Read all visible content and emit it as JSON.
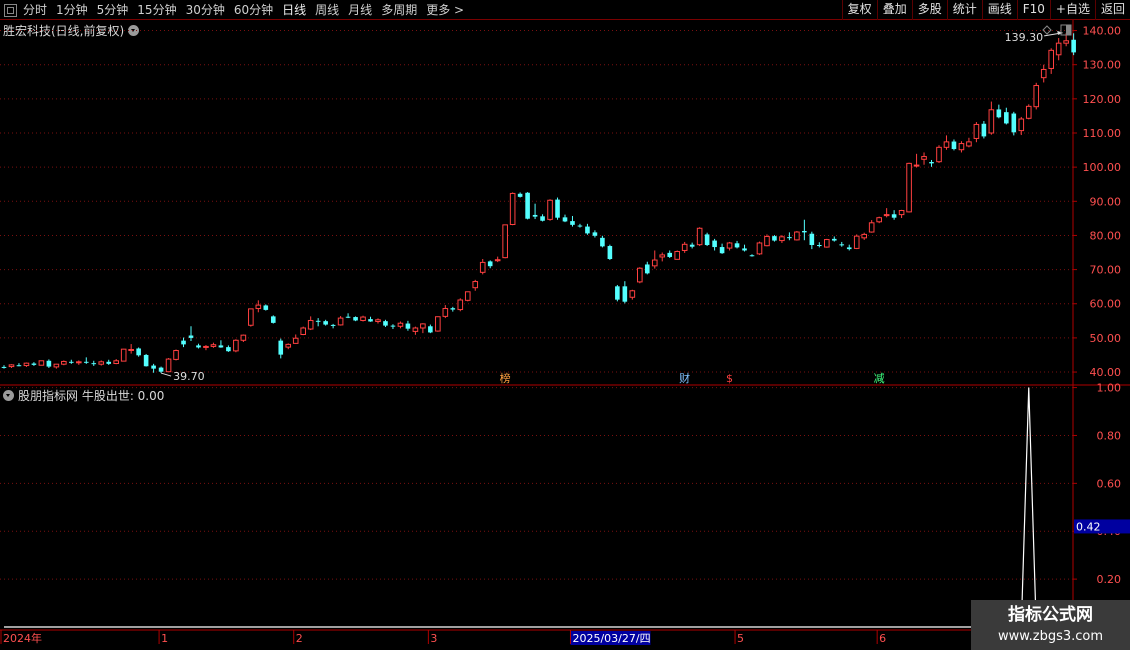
{
  "toolbar": {
    "periods": [
      "分时",
      "1分钟",
      "5分钟",
      "15分钟",
      "30分钟",
      "60分钟",
      "日线",
      "周线",
      "月线",
      "多周期",
      "更多 >"
    ],
    "active_period": "日线",
    "buttons": [
      "复权",
      "叠加",
      "多股",
      "统计",
      "画线",
      "F10",
      "+自选",
      "返回"
    ]
  },
  "stock_title": "胜宏科技(日线,前复权)",
  "indicator_title": "股朋指标网 牛股出世: 0.00",
  "watermark": {
    "line1": "指标公式网",
    "line2": "www.zbgs3.com"
  },
  "colors": {
    "up": "#ff4040",
    "down": "#54ffff",
    "grid": "#7a1010",
    "axis": "#b00000",
    "indicator_line": "#ffffff",
    "cursor_box": "#0000a0"
  },
  "chart_data": [
    {
      "type": "candlestick",
      "title": "胜宏科技(日线,前复权)",
      "ylim": [
        36.5,
        142.5
      ],
      "yticks": [
        "140.00",
        "130.00",
        "120.00",
        "110.00",
        "100.00",
        "90.00",
        "80.00",
        "70.00",
        "60.00",
        "50.00",
        "40.00"
      ],
      "annotations": {
        "low_label": "39.70",
        "high_label": "139.30"
      },
      "markers": [
        {
          "text": "榜",
          "color": "#ffa040"
        },
        {
          "text": "财",
          "color": "#80c0ff"
        },
        {
          "text": "$",
          "color": "#ff4040"
        },
        {
          "text": "减",
          "color": "#40ff80"
        }
      ],
      "candles_ohlc": [
        [
          41.5,
          42.0,
          41.0,
          41.3
        ],
        [
          41.6,
          42.3,
          41.2,
          42.1
        ],
        [
          42.0,
          42.6,
          41.7,
          41.8
        ],
        [
          41.9,
          42.8,
          41.5,
          42.6
        ],
        [
          42.5,
          42.9,
          41.8,
          42.1
        ],
        [
          42.0,
          43.4,
          41.9,
          43.3
        ],
        [
          43.3,
          43.7,
          41.2,
          41.6
        ],
        [
          41.5,
          42.4,
          41.0,
          42.3
        ],
        [
          42.3,
          43.4,
          42.0,
          43.1
        ],
        [
          43.0,
          43.6,
          42.4,
          42.8
        ],
        [
          42.8,
          43.4,
          42.1,
          43.0
        ],
        [
          43.0,
          44.3,
          42.4,
          42.8
        ],
        [
          42.6,
          43.3,
          41.8,
          42.4
        ],
        [
          42.3,
          43.4,
          41.9,
          43.0
        ],
        [
          43.0,
          43.6,
          42.1,
          42.4
        ],
        [
          42.5,
          43.8,
          42.3,
          43.3
        ],
        [
          43.2,
          46.8,
          43.1,
          46.7
        ],
        [
          46.6,
          48.2,
          45.4,
          46.6
        ],
        [
          46.9,
          47.2,
          44.5,
          44.9
        ],
        [
          45.0,
          45.3,
          41.6,
          41.7
        ],
        [
          41.9,
          42.4,
          39.8,
          41.0
        ],
        [
          41.3,
          41.6,
          39.7,
          40.1
        ],
        [
          40.1,
          44.1,
          40.0,
          43.8
        ],
        [
          43.7,
          46.6,
          43.4,
          46.3
        ],
        [
          49.2,
          50.1,
          47.3,
          48.1
        ],
        [
          50.7,
          53.4,
          49.1,
          50.0
        ],
        [
          47.8,
          48.3,
          46.9,
          47.2
        ],
        [
          47.2,
          47.9,
          46.4,
          47.5
        ],
        [
          47.5,
          48.6,
          47.1,
          48.0
        ],
        [
          47.8,
          49.3,
          47.1,
          47.2
        ],
        [
          47.3,
          47.8,
          45.9,
          46.1
        ],
        [
          46.2,
          49.6,
          45.8,
          49.3
        ],
        [
          49.3,
          51.0,
          48.8,
          50.8
        ],
        [
          53.7,
          58.6,
          53.3,
          58.5
        ],
        [
          58.6,
          61.0,
          57.5,
          59.6
        ],
        [
          59.5,
          59.8,
          58.0,
          58.2
        ],
        [
          56.3,
          56.6,
          54.2,
          54.4
        ],
        [
          49.2,
          49.8,
          44.0,
          45.1
        ],
        [
          47.3,
          48.4,
          46.7,
          48.1
        ],
        [
          48.4,
          51.0,
          48.3,
          49.9
        ],
        [
          51.0,
          53.3,
          50.8,
          52.9
        ],
        [
          52.6,
          56.3,
          52.3,
          55.1
        ],
        [
          55.0,
          55.8,
          53.4,
          54.9
        ],
        [
          54.9,
          55.3,
          53.6,
          53.9
        ],
        [
          53.8,
          54.1,
          52.8,
          53.6
        ],
        [
          53.8,
          56.4,
          53.6,
          55.8
        ],
        [
          56.2,
          57.2,
          55.8,
          56.1
        ],
        [
          56.1,
          56.3,
          54.9,
          55.1
        ],
        [
          55.1,
          56.5,
          54.8,
          56.1
        ],
        [
          55.5,
          56.2,
          54.7,
          54.8
        ],
        [
          54.8,
          55.7,
          54.2,
          55.3
        ],
        [
          54.9,
          55.3,
          53.2,
          53.6
        ],
        [
          53.6,
          54.0,
          52.6,
          53.3
        ],
        [
          53.4,
          54.8,
          52.8,
          54.3
        ],
        [
          54.2,
          55.0,
          52.1,
          52.7
        ],
        [
          51.9,
          53.3,
          50.9,
          52.9
        ],
        [
          52.9,
          54.3,
          51.4,
          54.1
        ],
        [
          53.4,
          53.9,
          51.4,
          51.6
        ],
        [
          52.0,
          56.3,
          51.8,
          56.2
        ],
        [
          56.3,
          59.6,
          55.8,
          58.6
        ],
        [
          58.7,
          59.1,
          57.7,
          58.3
        ],
        [
          58.3,
          61.6,
          57.8,
          61.1
        ],
        [
          61.0,
          63.6,
          60.7,
          63.5
        ],
        [
          64.7,
          67.0,
          63.8,
          66.5
        ],
        [
          69.2,
          73.1,
          68.6,
          72.1
        ],
        [
          72.4,
          72.7,
          70.4,
          71.0
        ],
        [
          72.6,
          73.8,
          72.2,
          72.9
        ],
        [
          73.5,
          83.2,
          73.3,
          83.1
        ],
        [
          83.2,
          92.6,
          83.0,
          92.3
        ],
        [
          92.2,
          92.6,
          91.1,
          91.3
        ],
        [
          92.5,
          92.7,
          84.7,
          84.9
        ],
        [
          86.0,
          89.3,
          84.8,
          85.5
        ],
        [
          85.6,
          86.2,
          84.1,
          84.3
        ],
        [
          84.7,
          90.6,
          84.3,
          90.3
        ],
        [
          90.5,
          91.1,
          84.6,
          85.2
        ],
        [
          85.3,
          86.1,
          83.9,
          84.1
        ],
        [
          84.2,
          85.7,
          82.6,
          83.1
        ],
        [
          82.9,
          83.4,
          82.3,
          82.7
        ],
        [
          82.6,
          83.4,
          80.2,
          80.6
        ],
        [
          80.9,
          81.5,
          79.4,
          79.9
        ],
        [
          79.3,
          79.9,
          76.5,
          76.8
        ],
        [
          76.9,
          77.3,
          72.8,
          73.1
        ],
        [
          65.1,
          65.5,
          60.7,
          61.2
        ],
        [
          65.1,
          66.6,
          60.1,
          60.6
        ],
        [
          61.9,
          64.1,
          61.2,
          63.8
        ],
        [
          66.4,
          70.7,
          66.0,
          70.4
        ],
        [
          71.5,
          72.3,
          68.6,
          68.9
        ],
        [
          71.1,
          75.6,
          70.3,
          72.8
        ],
        [
          73.7,
          75.0,
          72.4,
          74.3
        ],
        [
          74.9,
          75.6,
          73.4,
          73.7
        ],
        [
          73.0,
          75.6,
          72.9,
          75.3
        ],
        [
          75.6,
          78.1,
          74.9,
          77.4
        ],
        [
          77.3,
          77.9,
          76.2,
          76.7
        ],
        [
          77.3,
          82.4,
          76.9,
          82.1
        ],
        [
          80.3,
          80.8,
          76.9,
          77.2
        ],
        [
          78.5,
          79.0,
          75.6,
          76.6
        ],
        [
          76.6,
          77.6,
          74.6,
          74.8
        ],
        [
          76.3,
          78.1,
          75.6,
          77.8
        ],
        [
          77.7,
          78.4,
          76.2,
          76.5
        ],
        [
          76.2,
          77.3,
          75.3,
          75.6
        ],
        [
          74.2,
          74.5,
          73.8,
          74.1
        ],
        [
          74.6,
          78.2,
          74.3,
          77.8
        ],
        [
          77.0,
          80.3,
          76.8,
          79.7
        ],
        [
          79.8,
          80.1,
          78.2,
          78.5
        ],
        [
          78.5,
          80.1,
          77.8,
          79.6
        ],
        [
          79.5,
          80.9,
          78.6,
          79.2
        ],
        [
          78.7,
          81.3,
          78.5,
          81.0
        ],
        [
          81.3,
          84.6,
          78.6,
          80.9
        ],
        [
          80.5,
          81.1,
          76.0,
          77.2
        ],
        [
          77.2,
          78.0,
          76.5,
          76.9
        ],
        [
          76.6,
          79.0,
          76.4,
          78.8
        ],
        [
          79.0,
          79.7,
          78.2,
          78.5
        ],
        [
          77.4,
          78.1,
          76.7,
          77.1
        ],
        [
          76.5,
          77.3,
          75.6,
          76.0
        ],
        [
          76.2,
          80.3,
          76.0,
          79.8
        ],
        [
          79.3,
          80.8,
          78.7,
          80.3
        ],
        [
          81.0,
          84.5,
          80.8,
          83.7
        ],
        [
          84.0,
          85.5,
          83.6,
          85.2
        ],
        [
          85.8,
          88.0,
          85.3,
          86.1
        ],
        [
          86.2,
          87.4,
          84.6,
          85.2
        ],
        [
          86.1,
          87.5,
          85.1,
          87.3
        ],
        [
          86.9,
          101.3,
          86.7,
          101.1
        ],
        [
          100.4,
          103.9,
          99.9,
          100.6
        ],
        [
          102.3,
          104.3,
          100.7,
          103.1
        ],
        [
          101.5,
          102.1,
          100.1,
          101.1
        ],
        [
          101.6,
          106.4,
          101.2,
          105.8
        ],
        [
          105.8,
          109.3,
          105.1,
          107.4
        ],
        [
          107.5,
          108.1,
          104.9,
          105.3
        ],
        [
          105.1,
          107.6,
          104.3,
          106.9
        ],
        [
          106.2,
          108.6,
          105.8,
          107.4
        ],
        [
          108.4,
          113.2,
          107.3,
          112.5
        ],
        [
          112.7,
          113.5,
          108.4,
          109.0
        ],
        [
          110.0,
          119.2,
          109.5,
          116.8
        ],
        [
          116.9,
          118.3,
          114.3,
          114.6
        ],
        [
          116.1,
          117.4,
          112.5,
          112.8
        ],
        [
          115.7,
          116.2,
          109.3,
          110.2
        ],
        [
          110.7,
          114.7,
          109.4,
          114.1
        ],
        [
          114.3,
          118.4,
          114.0,
          117.8
        ],
        [
          117.7,
          124.7,
          116.9,
          123.9
        ],
        [
          126.2,
          130.0,
          124.8,
          128.6
        ],
        [
          128.9,
          134.8,
          127.3,
          134.2
        ],
        [
          132.9,
          137.8,
          131.3,
          136.3
        ],
        [
          136.3,
          139.3,
          135.4,
          137.0
        ],
        [
          137.3,
          139.2,
          132.8,
          133.6
        ]
      ],
      "x_axis_labels": [
        "2024年",
        "1",
        "2",
        "3",
        "2025/03/27/四",
        "5",
        "6"
      ]
    },
    {
      "type": "line",
      "series": [
        {
          "name": "牛股出世",
          "values_sparse": [
            {
              "index": 0,
              "value": 0
            },
            {
              "index": 136,
              "value": 0
            },
            {
              "index": 137,
              "value": 1.0
            },
            {
              "index": 138,
              "value": 0
            },
            {
              "index": 167,
              "value": 0
            }
          ]
        }
      ],
      "ylim": [
        0,
        1.04
      ],
      "yticks": [
        "1.00",
        "0.80",
        "0.60",
        "0.40",
        "0.20"
      ],
      "cursor_value": "0.42"
    }
  ]
}
